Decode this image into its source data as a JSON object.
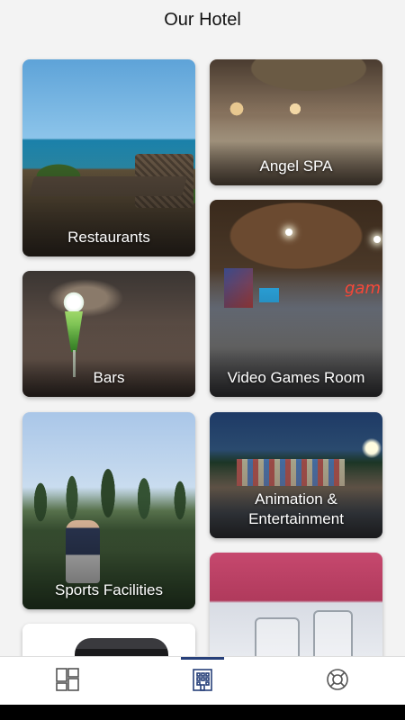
{
  "header": {
    "title": "Our Hotel"
  },
  "cards": [
    {
      "id": "restaurants",
      "label": "Restaurants"
    },
    {
      "id": "spa",
      "label": "Angel SPA"
    },
    {
      "id": "bars",
      "label": "Bars"
    },
    {
      "id": "games",
      "label": "Video Games Room",
      "neon_text": "gam"
    },
    {
      "id": "sports",
      "label": "Sports Facilities"
    },
    {
      "id": "animation",
      "label": "Animation &\nEntertainment"
    }
  ],
  "bottom_nav": {
    "items": [
      {
        "icon": "grid-layout-icon",
        "active": false
      },
      {
        "icon": "hotel-building-icon",
        "active": true
      },
      {
        "icon": "lifebuoy-icon",
        "active": false
      }
    ],
    "active_color": "#27407a",
    "icon_color": "#555555"
  }
}
